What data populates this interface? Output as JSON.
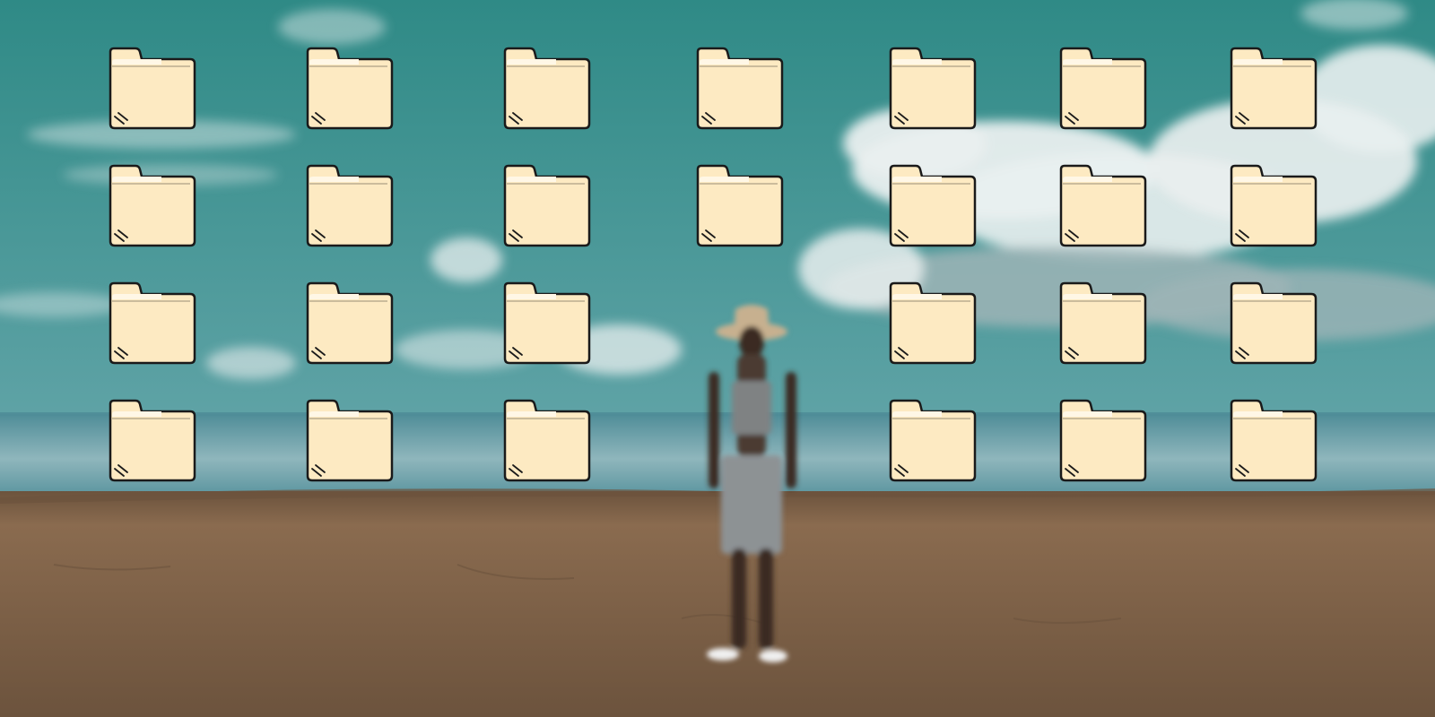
{
  "desktop": {
    "wallpaper": {
      "scene": "beach",
      "colors": {
        "sky_top": "#2f8a86",
        "sky_bottom": "#5fa3a6",
        "cloud": "#e9efef",
        "cloud_shadow": "#9db4b6",
        "sea": "#4f8d98",
        "sea_light": "#8fb6bc",
        "sand": "#8a6b4f",
        "sand_dark": "#6c533d"
      }
    },
    "icon_style": {
      "icon": "folder-icon",
      "fill": "#fdeac2",
      "tab_highlight": "#fff7e6",
      "outline": "#1a1a1a"
    },
    "icons": [
      {
        "icon": "folder-icon",
        "label": ""
      },
      {
        "icon": "folder-icon",
        "label": ""
      },
      {
        "icon": "folder-icon",
        "label": ""
      },
      {
        "icon": "folder-icon",
        "label": ""
      },
      {
        "icon": "folder-icon",
        "label": ""
      },
      {
        "icon": "folder-icon",
        "label": ""
      },
      {
        "icon": "folder-icon",
        "label": ""
      },
      {
        "icon": "folder-icon",
        "label": ""
      },
      {
        "icon": "folder-icon",
        "label": ""
      },
      {
        "icon": "folder-icon",
        "label": ""
      },
      {
        "icon": "folder-icon",
        "label": ""
      },
      {
        "icon": "folder-icon",
        "label": ""
      },
      {
        "icon": "folder-icon",
        "label": ""
      },
      {
        "icon": "folder-icon",
        "label": ""
      },
      {
        "icon": "folder-icon",
        "label": ""
      },
      {
        "icon": "folder-icon",
        "label": ""
      },
      {
        "icon": "folder-icon",
        "label": ""
      },
      {
        "icon": "folder-icon",
        "label": ""
      },
      {
        "icon": "folder-icon",
        "label": ""
      },
      {
        "icon": "folder-icon",
        "label": ""
      },
      {
        "icon": "folder-icon",
        "label": ""
      },
      {
        "icon": "folder-icon",
        "label": ""
      },
      {
        "icon": "folder-icon",
        "label": ""
      },
      {
        "icon": "folder-icon",
        "label": ""
      },
      {
        "icon": "folder-icon",
        "label": ""
      },
      {
        "icon": "folder-icon",
        "label": ""
      }
    ]
  }
}
